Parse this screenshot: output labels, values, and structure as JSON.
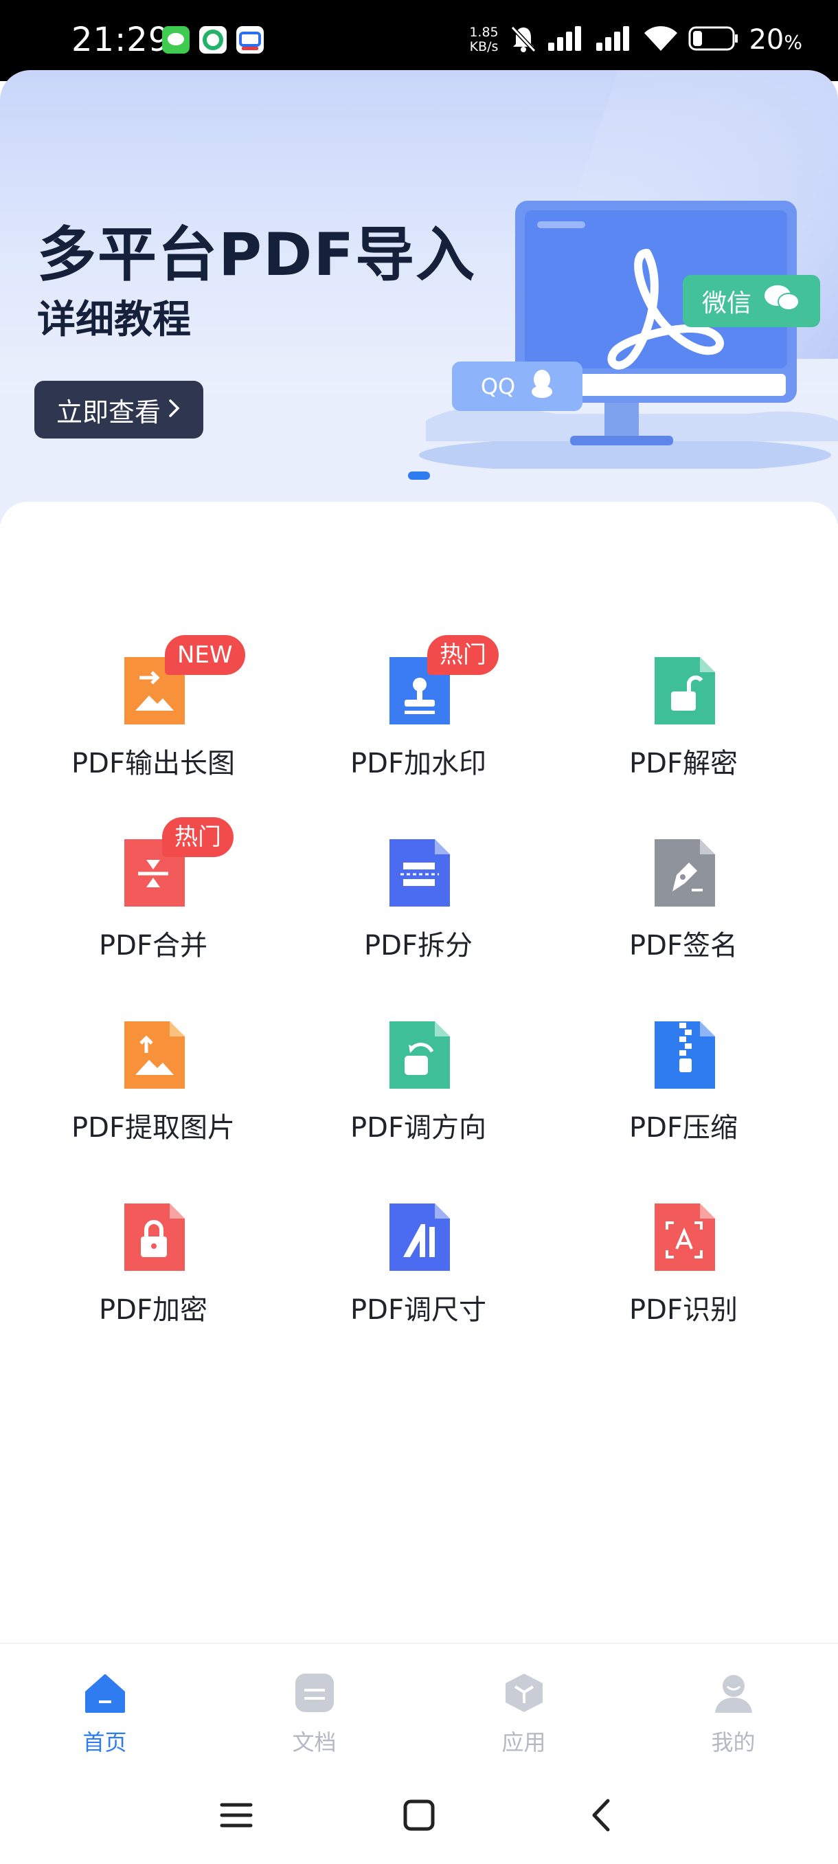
{
  "status_bar": {
    "time": "21:29",
    "network_speed_value": "1.85",
    "network_speed_unit": "KB/s",
    "battery_percent": "20",
    "battery_unit": "%",
    "notification_icons": [
      "messages-app-icon",
      "app-green-icon",
      "cloud-app-icon"
    ]
  },
  "banner": {
    "title": "多平台PDF导入",
    "subtitle": "详细教程",
    "cta_label": "立即查看",
    "qq_label": "QQ",
    "wechat_label": "微信",
    "active_slide": 1
  },
  "tools": [
    {
      "label": "PDF输出长图",
      "icon": "long-image-icon",
      "color": "#f7913a",
      "badge": "NEW"
    },
    {
      "label": "PDF加水印",
      "icon": "watermark-stamp-icon",
      "color": "#3b7cf2",
      "badge": "热门"
    },
    {
      "label": "PDF解密",
      "icon": "unlock-icon",
      "color": "#3fbf97",
      "badge": ""
    },
    {
      "label": "PDF合并",
      "icon": "merge-icon",
      "color": "#f35a5a",
      "badge": "热门"
    },
    {
      "label": "PDF拆分",
      "icon": "split-icon",
      "color": "#4b6cf0",
      "badge": ""
    },
    {
      "label": "PDF签名",
      "icon": "pen-signature-icon",
      "color": "#8f939c",
      "badge": ""
    },
    {
      "label": "PDF提取图片",
      "icon": "extract-image-icon",
      "color": "#f7913a",
      "badge": ""
    },
    {
      "label": "PDF调方向",
      "icon": "rotate-icon",
      "color": "#3fbf97",
      "badge": ""
    },
    {
      "label": "PDF压缩",
      "icon": "zip-icon",
      "color": "#2f7bf0",
      "badge": ""
    },
    {
      "label": "PDF加密",
      "icon": "lock-icon",
      "color": "#f35a5a",
      "badge": ""
    },
    {
      "label": "PDF调尺寸",
      "icon": "resize-icon",
      "color": "#4b6cf0",
      "badge": ""
    },
    {
      "label": "PDF识别",
      "icon": "ocr-scan-icon",
      "color": "#f35a5a",
      "badge": ""
    }
  ],
  "bottom_nav": [
    {
      "label": "首页",
      "icon": "home-icon",
      "active": true
    },
    {
      "label": "文档",
      "icon": "document-icon",
      "active": false
    },
    {
      "label": "应用",
      "icon": "apps-cube-icon",
      "active": false
    },
    {
      "label": "我的",
      "icon": "profile-icon",
      "active": false
    }
  ],
  "colors": {
    "accent": "#2f7bf0",
    "badge_new": "#f24b4b",
    "badge_hot": "#f24b4b",
    "nav_inactive": "#b3b8c2",
    "text_primary": "#1f2329",
    "banner_dark": "#15203a"
  }
}
